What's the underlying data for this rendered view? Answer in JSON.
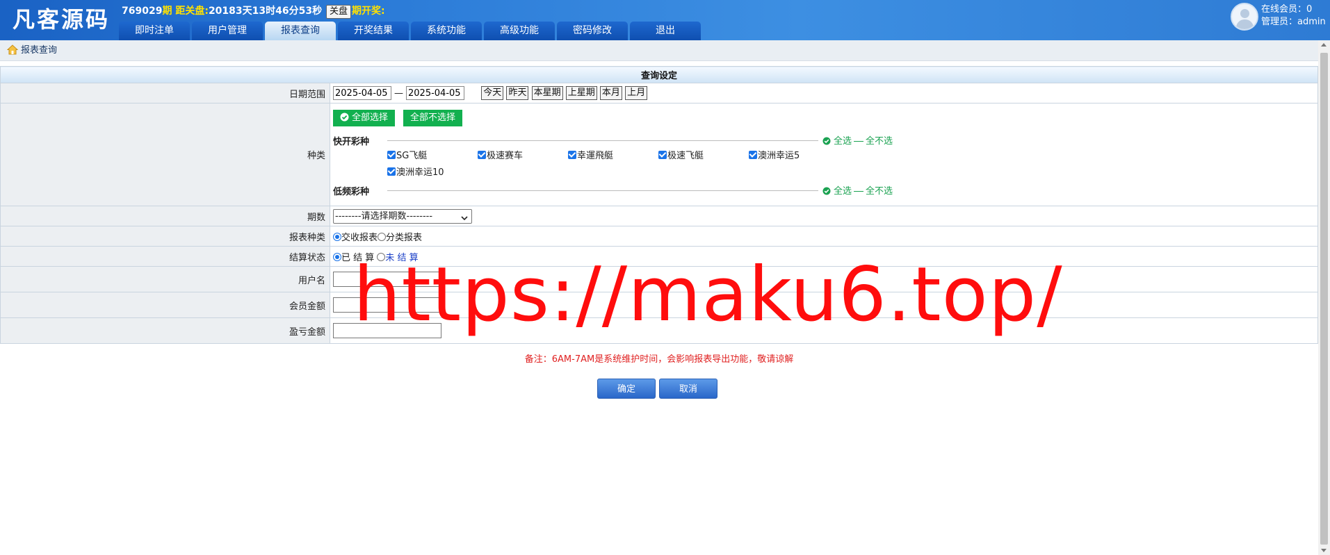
{
  "header": {
    "logo": "凡客源码",
    "period_number": "769029",
    "period_suffix": "期",
    "countdown_label": "距关盘:",
    "countdown_value": "20183天13时46分53秒",
    "close_button": "关盘",
    "draw_label": "期开奖:",
    "online_label": "在线会员：0",
    "admin_label": "管理员：admin"
  },
  "nav": {
    "tabs": [
      {
        "label": "即时注单"
      },
      {
        "label": "用户管理"
      },
      {
        "label": "报表查询"
      },
      {
        "label": "开奖结果"
      },
      {
        "label": "系统功能"
      },
      {
        "label": "高级功能"
      },
      {
        "label": "密码修改"
      },
      {
        "label": "退出"
      }
    ],
    "active": "报表查询"
  },
  "breadcrumb": {
    "label": "报表查询"
  },
  "form": {
    "section_title": "查询设定",
    "date_range": {
      "label": "日期范围",
      "start": "2025-04-05",
      "end": "2025-04-05",
      "separator": "—",
      "quick": [
        "今天",
        "昨天",
        "本星期",
        "上星期",
        "本月",
        "上月"
      ]
    },
    "category": {
      "label": "种类",
      "select_all": "全部选择",
      "select_none": "全部不选择",
      "groups": [
        {
          "title": "快开彩种",
          "all": "全选",
          "none": "全不选",
          "items": [
            "SG飞艇",
            "极速赛车",
            "幸運飛艇",
            "极速飞艇",
            "澳洲幸运5",
            "澳洲幸运10"
          ]
        },
        {
          "title": "低频彩种",
          "all": "全选",
          "none": "全不选",
          "items": []
        }
      ]
    },
    "period": {
      "label": "期数",
      "selected": "--------请选择期数--------"
    },
    "report_type": {
      "label": "报表种类",
      "options": [
        "交收报表",
        "分类报表"
      ],
      "selected": "交收报表"
    },
    "settle_status": {
      "label": "结算状态",
      "options": [
        "已 结 算",
        "未 结 算"
      ],
      "selected": "已 结 算"
    },
    "username": {
      "label": "用户名",
      "value": ""
    },
    "member_amount": {
      "label": "会员金额",
      "value": ""
    },
    "profit_amount": {
      "label": "盈亏金额",
      "value": ""
    }
  },
  "note": "备注：6AM-7AM是系统维护时间，会影响报表导出功能，敬请谅解",
  "actions": {
    "confirm": "确定",
    "cancel": "取消"
  },
  "watermark": "https://maku6.top/",
  "colors": {
    "header_blue": "#2c7cd8",
    "accent_green": "#12b04f",
    "note_red": "#e02020",
    "watermark_red": "#ff0d0d"
  }
}
